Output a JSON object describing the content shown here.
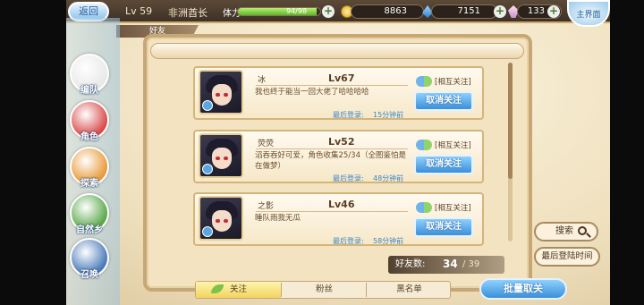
{
  "header": {
    "back_label": "返回",
    "level": "Lv 59",
    "username": "非洲酋长",
    "stamina_label": "体力",
    "stamina_text": "94/98",
    "stamina_fraction": 0.96,
    "gold": "8863",
    "gems": "7151",
    "crystals": "133",
    "main_label": "主界面",
    "section_tab": "好友"
  },
  "sidebar": {
    "items": [
      {
        "label": "编队",
        "icon": "team-icon",
        "color": "#e8e8e8"
      },
      {
        "label": "角色",
        "icon": "character-icon",
        "color": "#d94a4a"
      },
      {
        "label": "探索",
        "icon": "explore-icon",
        "color": "#e89a3a"
      },
      {
        "label": "自然乡",
        "icon": "nature-icon",
        "color": "#5aa84a"
      },
      {
        "label": "召唤",
        "icon": "summon-icon",
        "color": "#4a7ab8"
      }
    ]
  },
  "friends": [
    {
      "name": "冰",
      "level": "Lv67",
      "message": "我也终于能当一回大佬了哈哈哈哈",
      "last_login_label": "最后登录:",
      "last_login": "15分钟前",
      "mutual": "[相互关注]",
      "unfollow": "取消关注"
    },
    {
      "name": "荧荧",
      "level": "Lv52",
      "message": "滔吞吞好可爱，角色收集25/34（全图鉴怕是在做梦）",
      "last_login_label": "最后登录:",
      "last_login": "48分钟前",
      "mutual": "[相互关注]",
      "unfollow": "取消关注"
    },
    {
      "name": "之影",
      "level": "Lv46",
      "message": "睡队雨我无瓜",
      "last_login_label": "最后登录:",
      "last_login": "58分钟前",
      "mutual": "[相互关注]",
      "unfollow": "取消关注"
    }
  ],
  "controls": {
    "search": "搜索",
    "last_login_sort": "最后登陆时间",
    "friend_count_label": "好友数:",
    "friend_count": "34",
    "friend_max": "/ 39",
    "batch_unfollow": "批量取关"
  },
  "tabs": [
    {
      "label": "关注",
      "active": true
    },
    {
      "label": "粉丝",
      "active": false
    },
    {
      "label": "黑名单",
      "active": false
    }
  ]
}
